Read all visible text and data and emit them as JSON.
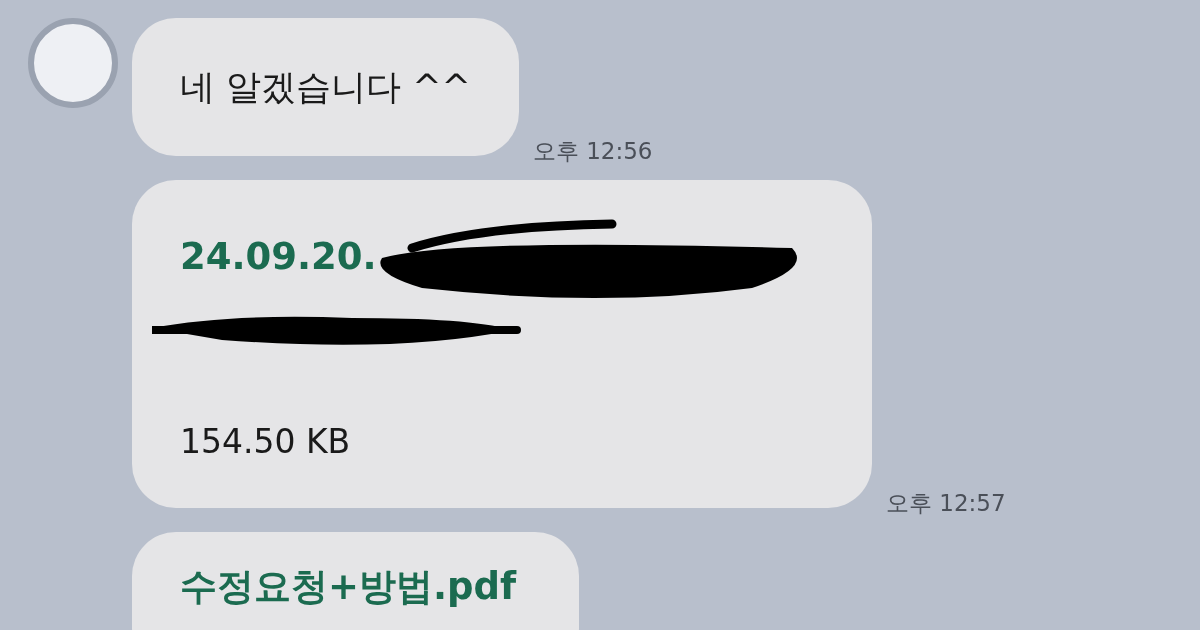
{
  "messages": [
    {
      "kind": "text",
      "text": "네 알겠습니다 ^^",
      "time": "오후 12:56",
      "avatar": true
    },
    {
      "kind": "file",
      "name": "24.09.20.",
      "redacted": true,
      "size": "154.50 KB",
      "time": "오후 12:57",
      "avatar": false
    },
    {
      "kind": "file",
      "name": "수정요청+방법.pdf",
      "redacted": false,
      "avatar": false
    }
  ]
}
